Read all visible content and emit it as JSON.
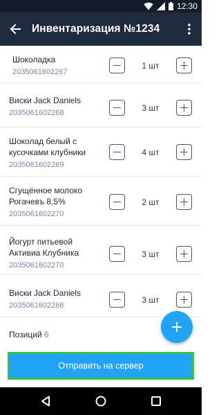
{
  "status_bar": {
    "time": "12:30"
  },
  "app_bar": {
    "title": "Инвентаризация №1234"
  },
  "items": [
    {
      "name": "Шоколадка",
      "code": "2035061602267",
      "qty": "1 шт"
    },
    {
      "name": "Виски Jack Daniels",
      "code": "2035061602268",
      "qty": "3 шт"
    },
    {
      "name": "Шоколад белый с кусочками клубники",
      "code": "2035061602269",
      "qty": "4 шт"
    },
    {
      "name": "Сгущённое молоко Рогачевъ 8,5%",
      "code": "2035061602270",
      "qty": "2 шт"
    },
    {
      "name": "Йогурт питьевой Активиа Клубника",
      "code": "2035061602270",
      "qty": "3 шт"
    },
    {
      "name": "Виски Jack Daniels",
      "code": "2035061602268",
      "qty": "3 шт"
    }
  ],
  "footer": {
    "positions_label": "Позиций",
    "positions_count": "6",
    "send_label": "Отправить на сервер"
  },
  "colors": {
    "app_bar": "#1f2a3c",
    "status_bar": "#151b28",
    "accent": "#22a3f5",
    "send_button_border": "#30c24a",
    "secondary_text": "#7985a0"
  },
  "icons": {
    "back": "arrow-back-icon",
    "menu": "more-vert-icon",
    "fab": "plus-icon",
    "nav": [
      "back-triangle-icon",
      "home-circle-icon",
      "recents-square-icon"
    ]
  }
}
